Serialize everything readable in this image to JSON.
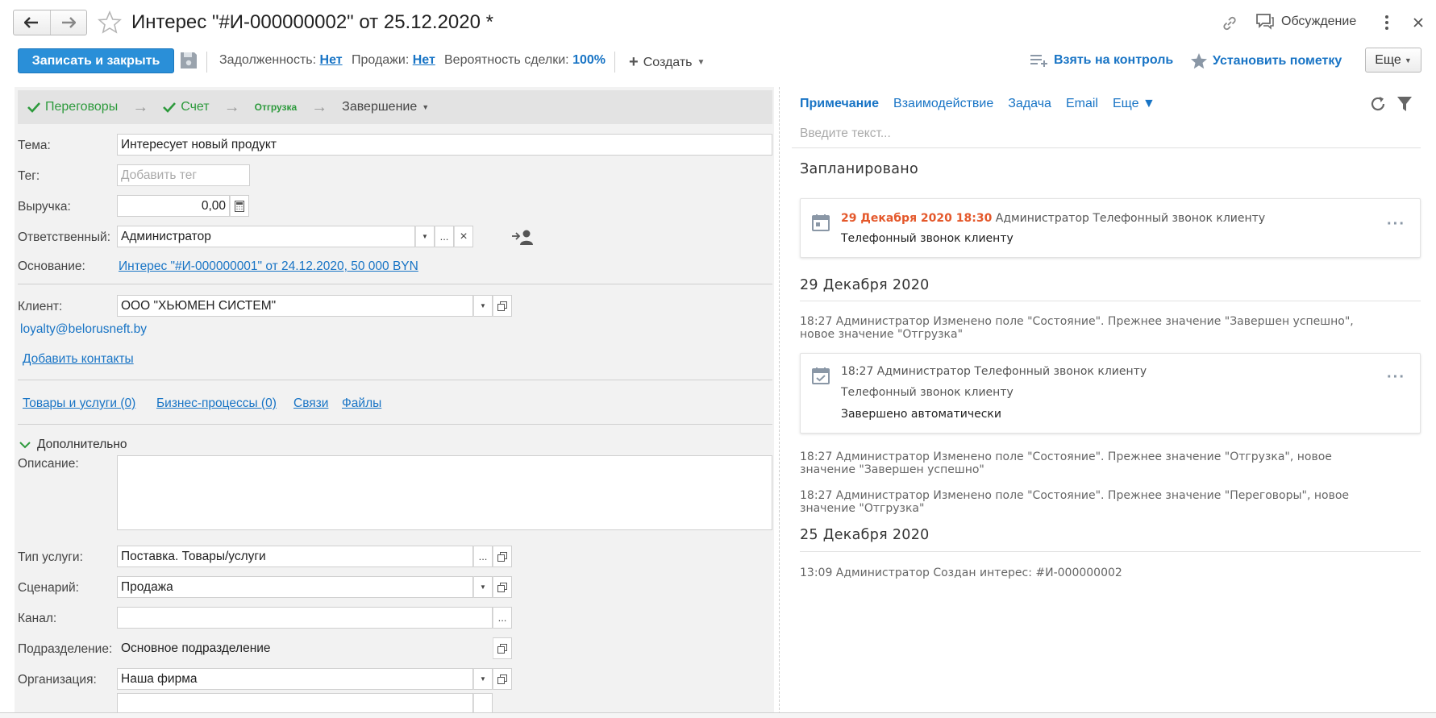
{
  "window": {
    "title": "Интерес \"#И-000000002\" от 25.12.2020 *",
    "discussion_label": "Обсуждение",
    "icons": [
      "back-arrow-icon",
      "forward-arrow-icon",
      "star-icon",
      "link-icon",
      "chat-icon",
      "more-vertical-icon",
      "close-icon"
    ]
  },
  "toolbar": {
    "save_close": "Записать и закрыть",
    "debt_label": "Задолженность:",
    "debt_value": "Нет",
    "sales_label": "Продажи:",
    "sales_value": "Нет",
    "probability_label": "Вероятность сделки:",
    "probability_value": "100%",
    "create_label": "Создать",
    "control_label": "Взять на контроль",
    "mark_label": "Установить пометку",
    "more_label": "Еще"
  },
  "stages": [
    {
      "label": "Переговоры",
      "done": true
    },
    {
      "label": "Счет",
      "done": true
    },
    {
      "label": "Отгрузка",
      "done": false,
      "current": true
    },
    {
      "label": "Завершение",
      "done": false
    }
  ],
  "form": {
    "topic_label": "Тема:",
    "topic_value": "Интересует новый продукт",
    "tag_label": "Тег:",
    "tag_placeholder": "Добавить тег",
    "revenue_label": "Выручка:",
    "revenue_value": "0,00",
    "responsible_label": "Ответственный:",
    "responsible_value": "Администратор",
    "basis_label": "Основание:",
    "basis_value": "Интерес \"#И-000000001\" от 24.12.2020, 50 000 BYN",
    "client_label": "Клиент:",
    "client_value": "ООО \"ХЬЮМЕН СИСТЕМ\"",
    "client_email": "loyalty@belorusneft.by",
    "add_contacts": "Добавить контакты",
    "links": [
      "Товары и услуги (0)",
      "Бизнес-процессы (0)",
      "Связи",
      "Файлы"
    ],
    "extra_label": "Дополнительно",
    "description_label": "Описание:",
    "service_type_label": "Тип услуги:",
    "service_type_value": "Поставка. Товары/услуги",
    "scenario_label": "Сценарий:",
    "scenario_value": "Продажа",
    "channel_label": "Канал:",
    "channel_value": "",
    "division_label": "Подразделение:",
    "division_value": "Основное подразделение",
    "organization_label": "Организация:",
    "organization_value": "Наша фирма",
    "ellipsis": "...",
    "clear": "×"
  },
  "right": {
    "tabs": [
      "Примечание",
      "Взаимодействие",
      "Задача",
      "Email",
      "Еще ▼"
    ],
    "note_placeholder": "Введите текст...",
    "planned_header": "Запланировано",
    "planned_card": {
      "date": "29 Декабря 2020 18:30",
      "meta": "Администратор Телефонный звонок клиенту",
      "text": "Телефонный звонок клиенту"
    },
    "day1_header": "29 Декабря 2020",
    "log1_a": "18:27 Администратор Изменено поле \"Состояние\". Прежнее значение \"Завершен успешно\",",
    "log1_b": "новое значение \"Отгрузка\"",
    "done_card": {
      "meta": "18:27 Администратор Телефонный звонок клиенту",
      "text": "Телефонный звонок клиенту",
      "status": "Завершено автоматически"
    },
    "log2_a": "18:27 Администратор Изменено поле \"Состояние\". Прежнее значение \"Отгрузка\", новое",
    "log2_b": "значение \"Завершен успешно\"",
    "log3_a": "18:27 Администратор Изменено поле \"Состояние\". Прежнее значение \"Переговоры\", новое",
    "log3_b": "значение \"Отгрузка\"",
    "day2_header": "25 Декабря 2020",
    "log4": "13:09 Администратор Создан интерес: #И-000000002",
    "dots": "···"
  },
  "colors": {
    "primary": "#2a8fd8",
    "link": "#1874c5",
    "success": "#2d9a3c",
    "accent_red": "#e4582b"
  }
}
